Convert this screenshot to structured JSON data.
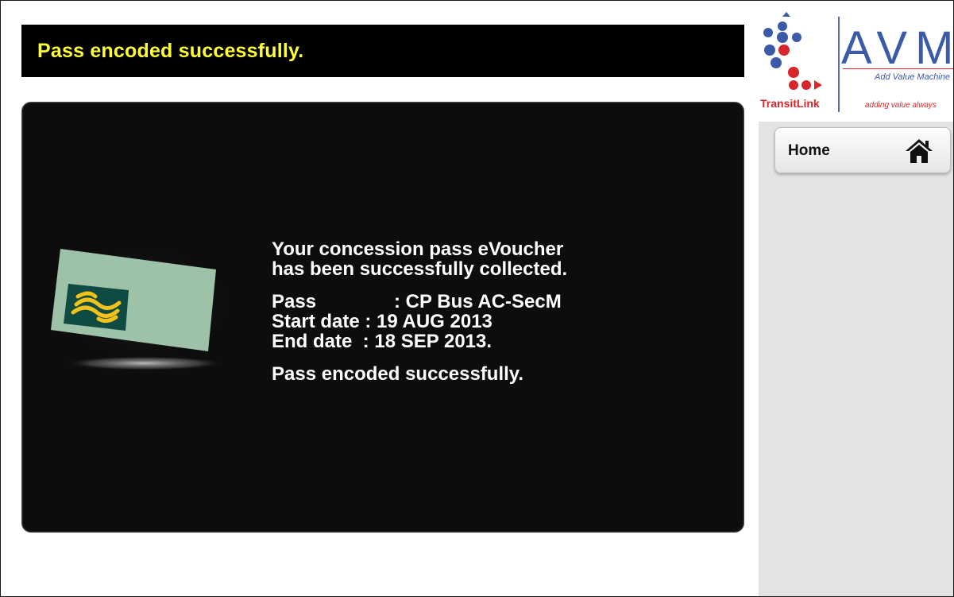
{
  "banner": {
    "text": "Pass encoded successfully."
  },
  "message": {
    "line1": "Your concession pass eVoucher",
    "line2": "has been successfully collected.",
    "pass_label": "Pass",
    "pass_sep": ": ",
    "pass_value": "CP Bus AC-SecM",
    "start_label": "Start date",
    "start_sep": " : ",
    "start_value": "19 AUG 2013",
    "end_label": "End date",
    "end_sep": "  : ",
    "end_value": "18 SEP 2013.",
    "footer": "Pass encoded successfully."
  },
  "logo": {
    "transitlink": "TransitLink",
    "avm": "AVM",
    "avm_subtitle": "Add Value Machine",
    "avm_tagline": "adding value always"
  },
  "sidebar": {
    "home_label": "Home",
    "home_icon": "house-icon"
  },
  "colors": {
    "banner_text": "#ffff33",
    "panel_bg": "#0d0d0d",
    "card": "#9ec2a8",
    "card_emblem": "#0f4a43",
    "brand_red": "#d9262b",
    "brand_blue": "#3b5aa8"
  }
}
